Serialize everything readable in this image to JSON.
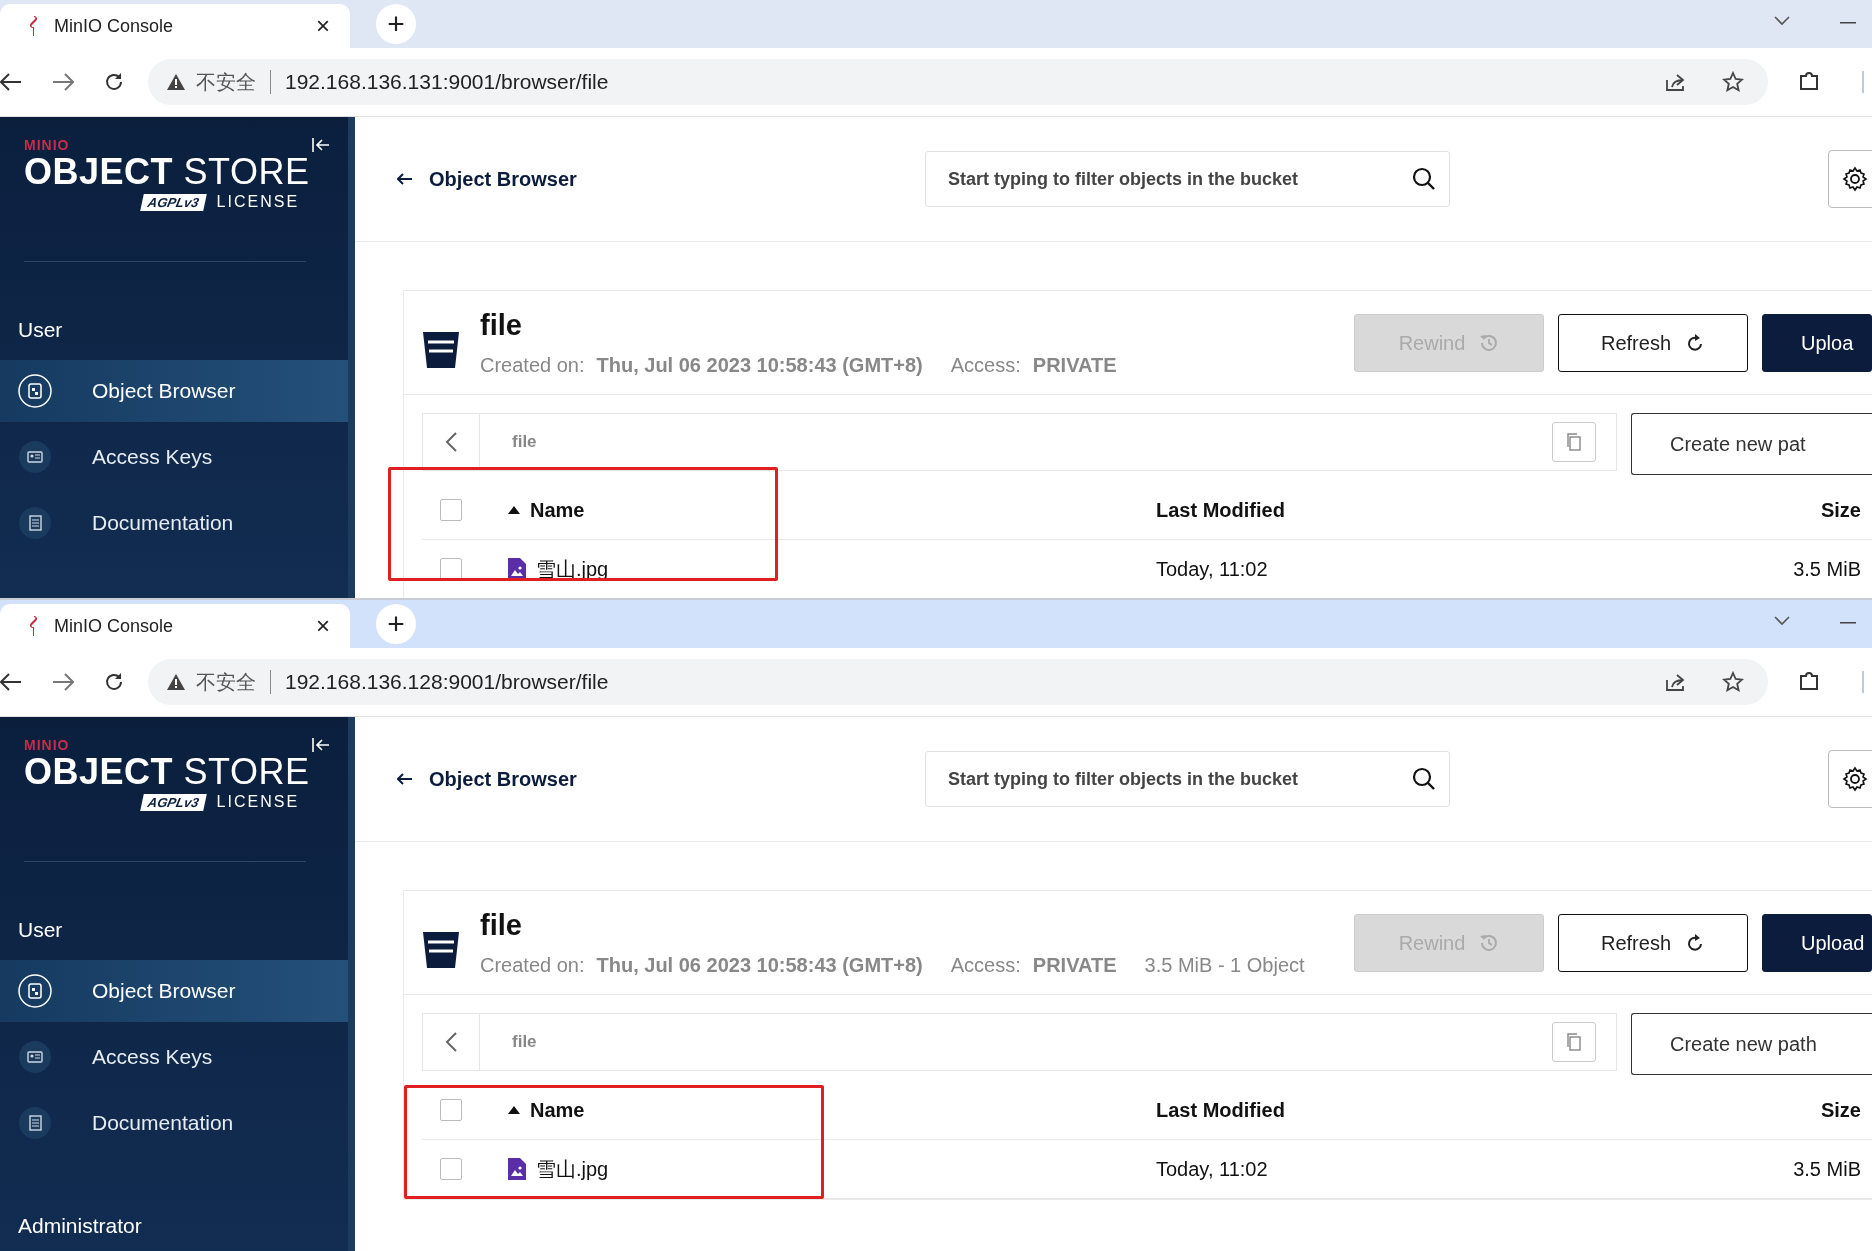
{
  "windows": [
    {
      "tab": {
        "title": "MinIO Console",
        "close": "×"
      },
      "new_tab": "+",
      "address": {
        "warning": "不安全",
        "url": "192.168.136.131:9001/browser/file"
      },
      "sidebar": {
        "brand": "MINIO",
        "title_bold": "OBJECT",
        "title": "STORE",
        "badge": "AGPLv3",
        "license": "LICENSE",
        "sections": [
          {
            "title": "User",
            "items": [
              {
                "label": "Object Browser",
                "kind": "browser",
                "selected": true
              },
              {
                "label": "Access Keys",
                "kind": "keys",
                "selected": false
              },
              {
                "label": "Documentation",
                "kind": "docs",
                "selected": false
              }
            ]
          }
        ]
      },
      "header": {
        "back_label": "Object Browser",
        "search_placeholder": "Start typing to filter objects in the bucket"
      },
      "bucket": {
        "name": "file",
        "meta": [
          {
            "label": "Created on:",
            "value": "Thu, Jul 06 2023 10:58:43 (GMT+8)"
          },
          {
            "label": "Access:",
            "value": "PRIVATE"
          }
        ],
        "buttons": [
          {
            "label": "Rewind",
            "kind": "rewind",
            "disabled": true
          },
          {
            "label": "Refresh",
            "kind": "refresh",
            "disabled": false
          },
          {
            "label": "Uploa",
            "kind": "upload",
            "disabled": false
          }
        ]
      },
      "path": {
        "crumb": "file",
        "create_label": "Create new pat"
      },
      "table": {
        "highlighted": true,
        "select_all_checked": false,
        "columns": [
          {
            "label": "Name",
            "sorted": true
          },
          {
            "label": "Last Modified",
            "sorted": false
          },
          {
            "label": "Size",
            "sorted": false
          }
        ],
        "rows": [
          {
            "name": "雪山.jpg",
            "modified": "Today, 11:02",
            "size": "3.5 MiB",
            "checked": false
          }
        ]
      }
    },
    {
      "tab": {
        "title": "MinIO Console",
        "close": "×"
      },
      "new_tab": "+",
      "address": {
        "warning": "不安全",
        "url": "192.168.136.128:9001/browser/file"
      },
      "sidebar": {
        "brand": "MINIO",
        "title_bold": "OBJECT",
        "title": "STORE",
        "badge": "AGPLv3",
        "license": "LICENSE",
        "sections": [
          {
            "title": "User",
            "items": [
              {
                "label": "Object Browser",
                "kind": "browser",
                "selected": true
              },
              {
                "label": "Access Keys",
                "kind": "keys",
                "selected": false
              },
              {
                "label": "Documentation",
                "kind": "docs",
                "selected": false
              }
            ]
          },
          {
            "title": "Administrator"
          }
        ]
      },
      "header": {
        "back_label": "Object Browser",
        "search_placeholder": "Start typing to filter objects in the bucket"
      },
      "bucket": {
        "name": "file",
        "meta": [
          {
            "label": "Created on:",
            "value": "Thu, Jul 06 2023 10:58:43 (GMT+8)"
          },
          {
            "label": "Access:",
            "value": "PRIVATE"
          }
        ],
        "summary": "3.5 MiB - 1 Object",
        "buttons": [
          {
            "label": "Rewind",
            "kind": "rewind",
            "disabled": true
          },
          {
            "label": "Refresh",
            "kind": "refresh",
            "disabled": false
          },
          {
            "label": "Upload",
            "kind": "upload",
            "disabled": false
          }
        ]
      },
      "path": {
        "crumb": "file",
        "create_label": "Create new path"
      },
      "table": {
        "highlighted": true,
        "select_all_checked": false,
        "columns": [
          {
            "label": "Name",
            "sorted": true
          },
          {
            "label": "Last Modified",
            "sorted": false
          },
          {
            "label": "Size",
            "sorted": false
          }
        ],
        "rows": [
          {
            "name": "雪山.jpg",
            "modified": "Today, 11:02",
            "size": "3.5 MiB",
            "checked": false
          }
        ]
      }
    }
  ]
}
